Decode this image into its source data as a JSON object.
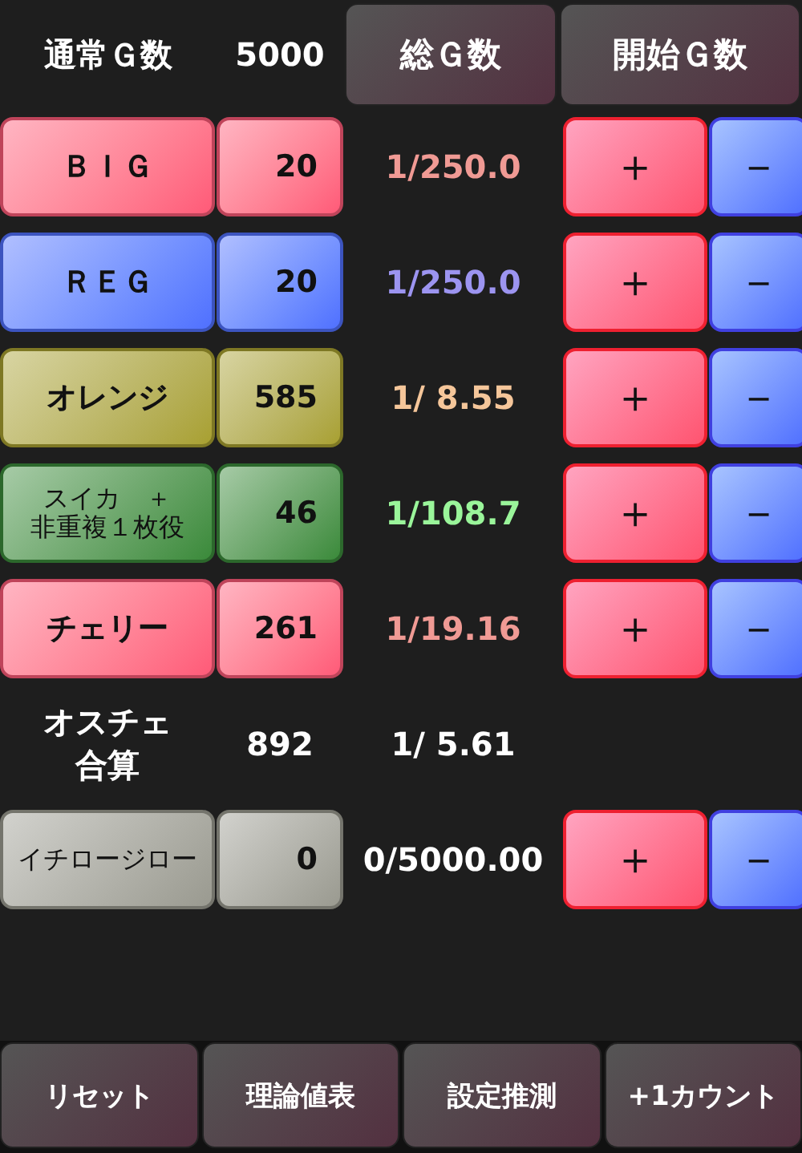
{
  "header": {
    "label": "通常Ｇ数",
    "value": "5000",
    "buttons": [
      "総Ｇ数",
      "開始Ｇ数"
    ]
  },
  "rows": [
    {
      "kind": "counter",
      "button": {
        "color": "#ff5a78"
      },
      "label": [
        "ＢＩＧ"
      ],
      "count": "20",
      "ratio": "1/250.0",
      "color": "#f09a94",
      "plus": "＋",
      "minus": "－"
    },
    {
      "kind": "counter",
      "button": {
        "color": "#5070ff"
      },
      "label": [
        "ＲＥＧ"
      ],
      "count": "20",
      "ratio": "1/250.0",
      "color": "#9c94f0",
      "plus": "＋",
      "minus": "－"
    },
    {
      "kind": "counter",
      "button": {
        "color": "#a8a030"
      },
      "label": [
        "オレンジ"
      ],
      "count": "585",
      "ratio": "1/ 8.55",
      "color": "#f5c69a",
      "plus": "＋",
      "minus": "－"
    },
    {
      "kind": "counter",
      "button": {
        "color": "#3a8a3a"
      },
      "label": [
        "スイカ　＋",
        "非重複１枚役"
      ],
      "count": "46",
      "ratio": "1/108.7",
      "color": "#9af59a",
      "plus": "＋",
      "minus": "－"
    },
    {
      "kind": "counter",
      "button": {
        "color": "#ff5a78"
      },
      "label": [
        "チェリー"
      ],
      "count": "261",
      "ratio": "1/19.16",
      "color": "#f09a94",
      "plus": "＋",
      "minus": "－"
    },
    {
      "kind": "total",
      "label": [
        "オスチェ",
        "合算"
      ],
      "count": "892",
      "ratio": "1/ 5.61",
      "color": "#ffffff"
    },
    {
      "kind": "counter",
      "button": {
        "color": "#9a9a90"
      },
      "label": [
        "イチロージロー"
      ],
      "count": "0",
      "ratio": "0/5000.00",
      "color": "#ffffff",
      "plus": "＋",
      "minus": "－"
    }
  ],
  "footer": [
    "リセット",
    "理論値表",
    "設定推測",
    "+1カウント"
  ]
}
